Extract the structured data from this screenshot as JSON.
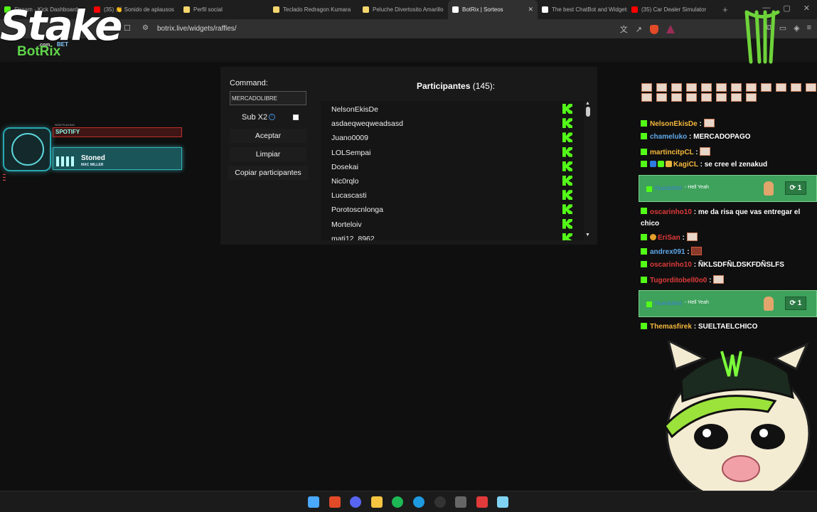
{
  "browser": {
    "tabs": [
      {
        "label": "Stream - Kick Dashboard",
        "icon_color": "#53fc18",
        "active": false
      },
      {
        "label": "(35) 👏 Sonido de aplausos",
        "icon_color": "#ff0000",
        "active": false
      },
      {
        "label": "Perfil social",
        "icon_color": "#f5d76e",
        "active": false
      },
      {
        "label": "Teclado Redragon Kumara",
        "icon_color": "#f5d76e",
        "active": false
      },
      {
        "label": "Peluche Divertosito Amarillo",
        "icon_color": "#f5d76e",
        "active": false
      },
      {
        "label": "BotRix | Sorteos",
        "icon_color": "#ffffff",
        "active": true
      },
      {
        "label": "The best ChatBot and Widgets",
        "icon_color": "#ffffff",
        "active": false
      },
      {
        "label": "(35) Car Dealer Simulator",
        "icon_color": "#ff0000",
        "active": false
      }
    ],
    "url": "botrix.live/widgets/raffles/",
    "close_tab_glyph": "✕",
    "new_tab_glyph": "+"
  },
  "overlay": {
    "stake_text": "Stake",
    "stake_com": ".com",
    "stake_bet": "BET",
    "botrix_text": "BotRix",
    "spotify_label": "SPOTIFY",
    "spotify_tiny": "NOW PLAYING",
    "song_title": "Stoned",
    "song_artist": "MAC MILLER"
  },
  "raffle": {
    "command_label": "Command:",
    "command_value": "MERCADOLIBRE",
    "sub_label": "Sub X2",
    "info_glyph": "i",
    "accept_button": "Aceptar",
    "clear_button": "Limpiar",
    "copy_button": "Copiar participantes",
    "participants_title": "Participantes",
    "participants_count": "(145):",
    "participants": [
      "NelsonEkisDe",
      "asdaeqweqweadsasd",
      "Juano0009",
      "LOLSempai",
      "Dosekai",
      "Nic0rqlo",
      "Lucascasti",
      "Porotoscnlonga",
      "Morteloiv",
      "mati12_8962"
    ]
  },
  "chat": {
    "emote_count": 20,
    "messages": [
      {
        "user": "NelsonEkisDe",
        "color": "#f5b83d",
        "text": "",
        "emote": true
      },
      {
        "user": "chameluko",
        "color": "#5fa8e8",
        "text": "MERCADOPAGO",
        "emote": false
      },
      {
        "user": "martincitpCL",
        "color": "#f5b83d",
        "text": "",
        "emote": true
      },
      {
        "user": "KagiCL",
        "color": "#f5b83d",
        "text": "se cree el zenakud",
        "emote": false
      }
    ],
    "follow_1": {
      "name": "Hueolofesl",
      "msg": "- Hell Yeah",
      "count": "1"
    },
    "wrap_message": {
      "user": "oscarinho10",
      "color": "#e03a3a",
      "text": "me da risa que vas entregar el chico"
    },
    "messages_2": [
      {
        "user": "EriSan",
        "color": "#e03a3a",
        "text": "",
        "emote": true
      },
      {
        "user": "andrex091",
        "color": "#5fa8e8",
        "text": "",
        "emote": true
      },
      {
        "user": "oscarinho10",
        "color": "#e03a3a",
        "text": "ÑKLSDFÑLDSKFDÑSLFS",
        "emote": false
      },
      {
        "user": "Tugorditobell0o0",
        "color": "#e03a3a",
        "text": "",
        "emote": true
      }
    ],
    "follow_2": {
      "name": "Hueolofesl",
      "msg": "- Hell Yeah",
      "count": "1"
    },
    "last_message": {
      "user": "Themasfirek",
      "color": "#f5b83d",
      "text": "SUELTAELCHICO"
    },
    "colon": ":"
  },
  "taskbar": {
    "icons": [
      "windows-start-icon",
      "brave-browser-icon",
      "discord-icon",
      "file-explorer-icon",
      "spotify-icon",
      "edge-icon",
      "obs-icon",
      "steam-icon",
      "valorant-icon",
      "desktop-app-icon"
    ],
    "colors": [
      "#4aa8ff",
      "#e24a28",
      "#5865f2",
      "#f5c542",
      "#1db954",
      "#1e9be0",
      "#333333",
      "#666666",
      "#e03a3a",
      "#7fd3f0"
    ]
  },
  "colors": {
    "kick_green": "#53fc18",
    "panel_bg": "#191919",
    "follow_green": "#3ea15c"
  }
}
